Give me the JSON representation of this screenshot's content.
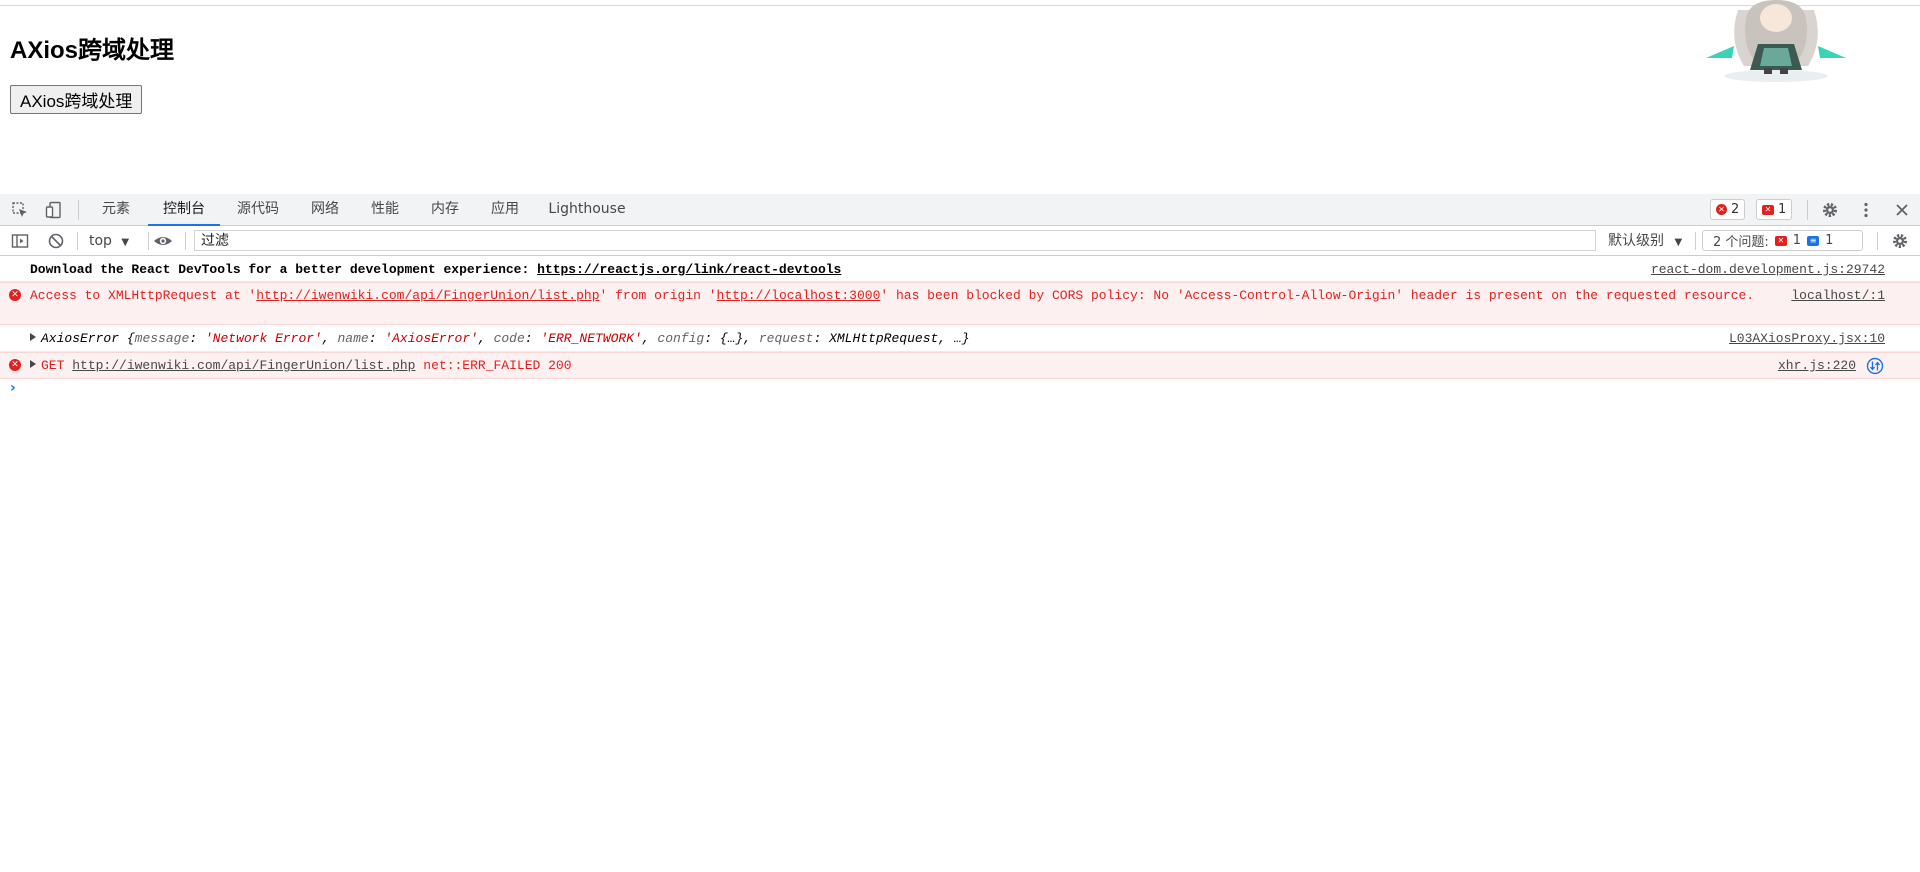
{
  "page": {
    "heading": "AXios跨域处理",
    "button_label": "AXios跨域处理"
  },
  "devtools": {
    "tabs": [
      "元素",
      "控制台",
      "源代码",
      "网络",
      "性能",
      "内存",
      "应用",
      "Lighthouse"
    ],
    "active_tab": "控制台",
    "error_count": "2",
    "issue_count": "1",
    "toolbar": {
      "context": "top",
      "filter_placeholder": "过滤",
      "level": "默认级别",
      "issues_label": "2 个问题:",
      "issues_error": "1",
      "issues_info": "1"
    },
    "messages": {
      "devtools_hint": {
        "text": "Download the React DevTools for a better development experience: ",
        "link": "https://reactjs.org/link/react-devtools",
        "source": "react-dom.development.js:29742"
      },
      "cors": {
        "part1": "Access to XMLHttpRequest at '",
        "url": "http://iwenwiki.com/api/FingerUnion/list.php",
        "part2": "' from origin '",
        "origin": "http://localhost:3000",
        "part3": "' has been blocked by CORS policy: No 'Access-Control-Allow-Origin' header is present on the requested resource.",
        "source": "localhost/:1"
      },
      "axios_error": {
        "name": "AxiosError",
        "k_message": "message",
        "v_message": "'Network Error'",
        "k_name": "name",
        "v_name": "'AxiosError'",
        "k_code": "code",
        "v_code": "'ERR_NETWORK'",
        "k_config": "config",
        "v_config": "{…}",
        "k_request": "request",
        "v_request": "XMLHttpRequest",
        "ellipsis": "…}",
        "source": "L03AXiosProxy.jsx:10"
      },
      "get_failed": {
        "method": "GET",
        "url": "http://iwenwiki.com/api/FingerUnion/list.php",
        "status": "net::ERR_FAILED 200",
        "source": "xhr.js:220"
      }
    },
    "prompt": "›"
  },
  "colors": {
    "accent": "#1a73e8",
    "error": "#e4201f",
    "error_bg": "#fdf0f0"
  }
}
